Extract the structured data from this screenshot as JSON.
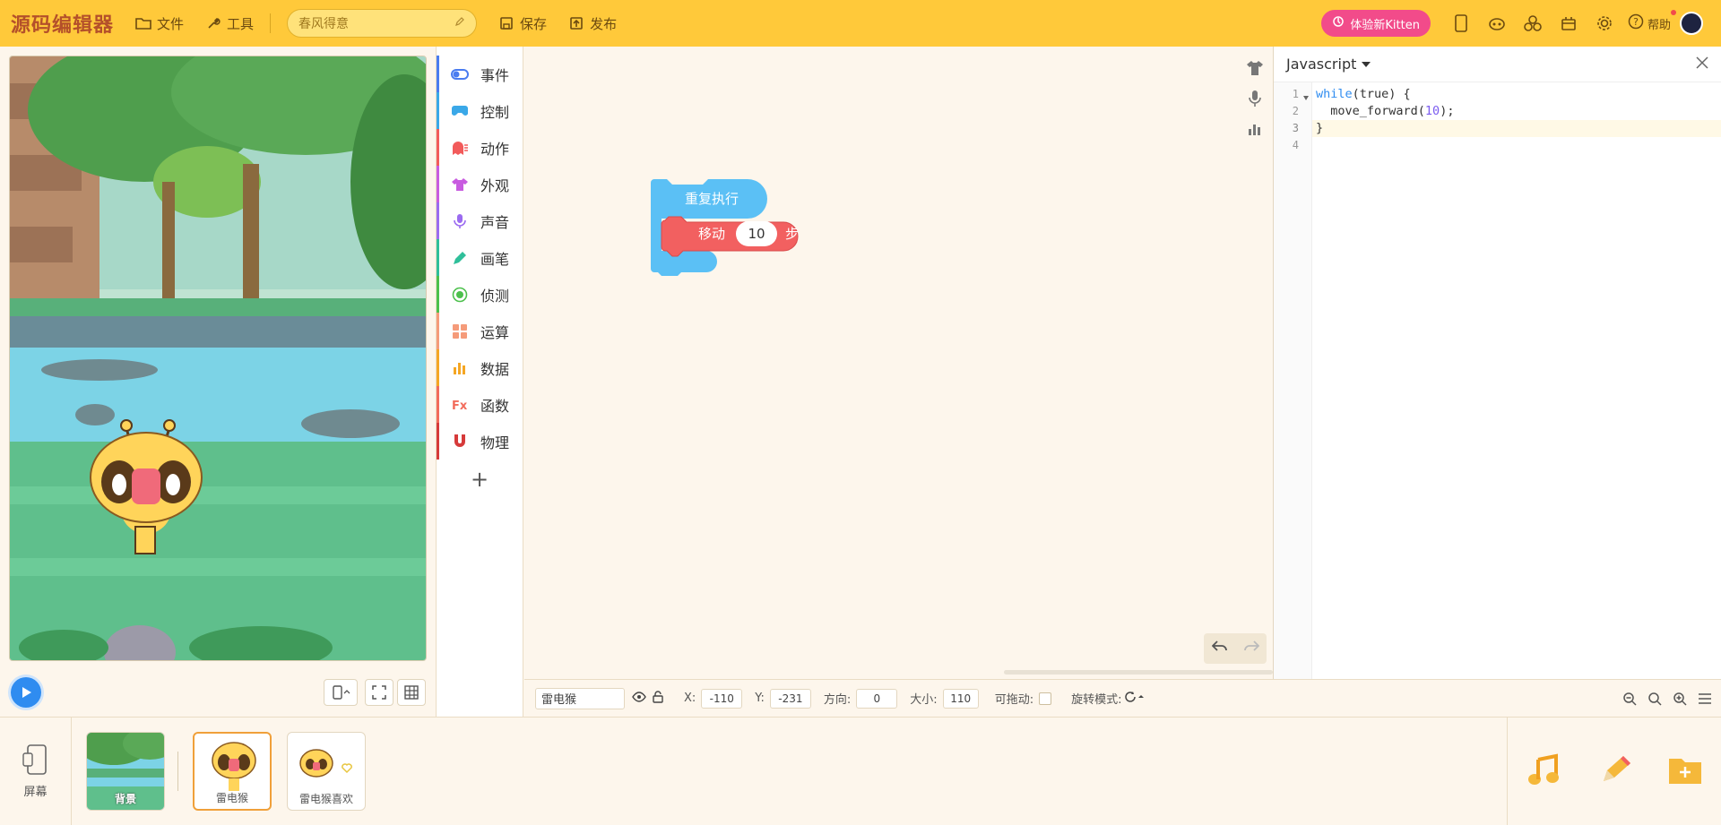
{
  "topbar": {
    "logo": "源码编辑器",
    "file_label": "文件",
    "tools_label": "工具",
    "project_name": "春风得意",
    "save_label": "保存",
    "publish_label": "发布",
    "kitten_label": "体验新Kitten",
    "help_label": "帮助"
  },
  "categories": [
    {
      "label": "事件",
      "icon": "toggle-icon",
      "color": "#4a7cf0"
    },
    {
      "label": "控制",
      "icon": "gamepad-icon",
      "color": "#3aa8e8"
    },
    {
      "label": "动作",
      "icon": "ghost-icon",
      "color": "#f25b5b"
    },
    {
      "label": "外观",
      "icon": "shirt-icon",
      "color": "#c85be0"
    },
    {
      "label": "声音",
      "icon": "mic-icon",
      "color": "#9b6bf0"
    },
    {
      "label": "画笔",
      "icon": "pen-icon",
      "color": "#2fbf9a"
    },
    {
      "label": "侦测",
      "icon": "radar-icon",
      "color": "#4cc04c"
    },
    {
      "label": "运算",
      "icon": "grid-icon",
      "color": "#f59b7a"
    },
    {
      "label": "数据",
      "icon": "bar-chart-icon",
      "color": "#f5a623"
    },
    {
      "label": "函数",
      "icon": "function-icon",
      "color": "#f26b5b"
    },
    {
      "label": "物理",
      "icon": "magnet-icon",
      "color": "#d63a3a"
    }
  ],
  "blocks": {
    "repeat_label": "重复执行",
    "move_label": "移动",
    "move_value": "10",
    "move_unit": "步",
    "repeat_color": "#5bc0f5",
    "move_color": "#f26060"
  },
  "code_panel": {
    "language": "Javascript",
    "line_numbers": [
      "1",
      "2",
      "3",
      "4"
    ],
    "lines": [
      {
        "kw": "while",
        "rest": "(true) {"
      },
      {
        "pre": "  move_forward(",
        "num": "10",
        "post": ");"
      },
      {
        "plain": "}"
      },
      {
        "plain": ""
      }
    ]
  },
  "status": {
    "sprite_name": "雷电猴",
    "x_label": "X:",
    "x_value": "-110",
    "y_label": "Y:",
    "y_value": "-231",
    "direction_label": "方向:",
    "direction_value": "0",
    "size_label": "大小:",
    "size_value": "110",
    "draggable_label": "可拖动:",
    "rotation_label": "旋转模式:"
  },
  "sprites": {
    "screen_label": "屏幕",
    "items": [
      {
        "name": "背景"
      },
      {
        "name": "雷电猴"
      },
      {
        "name": "雷电猴喜欢"
      }
    ]
  },
  "colors": {
    "topbar": "#ffc93a",
    "accent_blue": "#2f8cf0",
    "kitten_pink": "#f24b8a"
  }
}
